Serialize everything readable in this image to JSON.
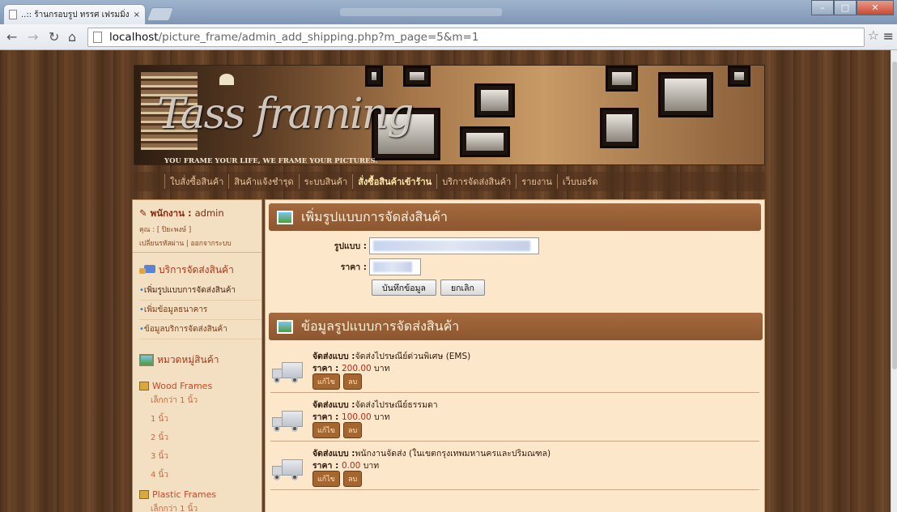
{
  "browser": {
    "tab_title": "..:: ร้านกรอบรูป ทรรศ เฟรมมิ่ง",
    "tab_close": "×",
    "url_host": "localhost",
    "url_path": "/picture_frame/admin_add_shipping.php?m_page=5&m=1"
  },
  "banner": {
    "brand": "Tass framing",
    "slogan": "YOU FRAME YOUR LIFE, WE FRAME YOUR PICTURES."
  },
  "topnav": {
    "items": [
      "ใบสั่งซื้อสินค้า",
      "สินค้าแจ้งชำรุด",
      "ระบบสินค้า",
      "สั่งซื้อสินค้าเข้าร้าน",
      "บริการจัดส่งสินค้า",
      "รายงาน",
      "เว็บบอร์ด"
    ]
  },
  "left": {
    "user_label": "พนักงาน : ",
    "user_name": "admin",
    "user_sub": "คุณ : [ ปิยะพงษ์ ]",
    "user_links": "เปลี่ยนรหัสผ่าน | ออกจากระบบ",
    "shipping_title": "บริการจัดส่งสินค้า",
    "shipping_items": [
      "เพิ่มรูปแบบการจัดส่งสินค้า",
      "เพิ่มข้อมูลธนาคาร",
      "ข้อมูลบริการจัดส่งสินค้า"
    ],
    "category_title": "หมวดหมู่สินค้า",
    "cat1": "Wood Frames",
    "cat1_items": [
      "เล็กกว่า 1 นิ้ว",
      "1 นิ้ว",
      "2 นิ้ว",
      "3 นิ้ว",
      "4 นิ้ว"
    ],
    "cat2": "Plastic Frames",
    "cat2_items": [
      "เล็กกว่า 1 นิ้ว"
    ]
  },
  "form": {
    "title": "เพิ่มรูปแบบการจัดส่งสินค้า",
    "pattern_label": "รูปแบบ :",
    "price_label": "ราคา :",
    "save_label": "บันทึกข้อมูล",
    "cancel_label": "ยกเลิก"
  },
  "list": {
    "title": "ข้อมูลรูปแบบการจัดส่งสินค้า",
    "method_label": "จัดส่งแบบ :",
    "price_label": "ราคา : ",
    "unit": " บาท",
    "edit_label": "แก้ไข",
    "delete_label": "ลบ",
    "rows": [
      {
        "method": "จัดส่งไปรษณีย์ด่วนพิเศษ (EMS)",
        "price": "200.00"
      },
      {
        "method": "จัดส่งไปรษณีย์ธรรมดา",
        "price": "100.00"
      },
      {
        "method": "พนักงานจัดส่ง (ในเขตกรุงเทพมหานครและปริมณฑล)",
        "price": "0.00"
      }
    ]
  }
}
